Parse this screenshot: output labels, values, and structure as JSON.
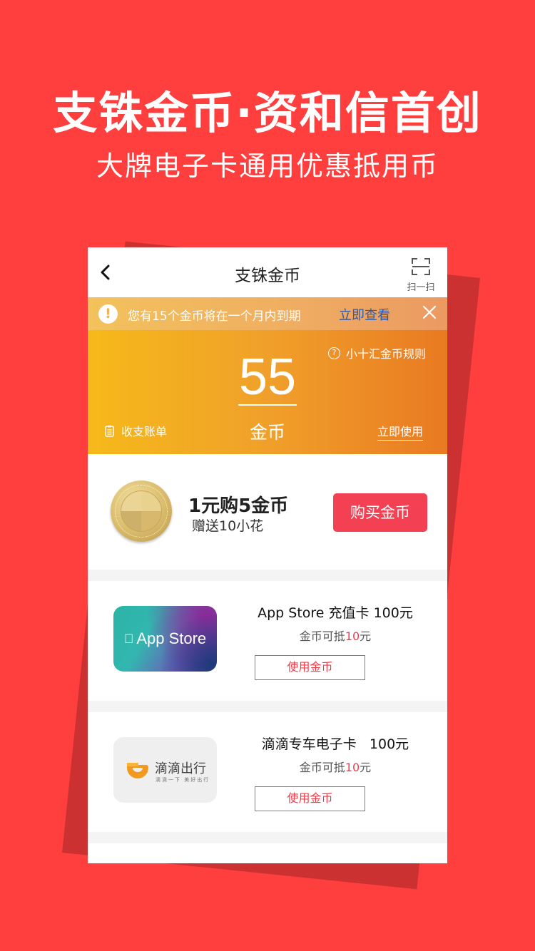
{
  "promo": {
    "headline": "支铢金币·资和信首创",
    "subline": "大牌电子卡通用优惠抵用币"
  },
  "navbar": {
    "title": "支铢金币",
    "back_icon": "chevron-left-icon",
    "scan_label": "扫一扫",
    "scan_icon": "scan-icon"
  },
  "notice": {
    "icon": "exclamation-icon",
    "text": "您有15个金币将在一个月内到期",
    "link": "立即查看",
    "close_icon": "close-icon"
  },
  "balance": {
    "rules_label": "小十汇金币规则",
    "rules_icon": "question-circle-icon",
    "value": "55",
    "unit": "金币",
    "bill_label": "收支账单",
    "bill_icon": "clipboard-icon",
    "use_now_label": "立即使用"
  },
  "buy": {
    "title": "1元购5金币",
    "subtitle": "赠送10小花",
    "button_label": "购买金币"
  },
  "cards": [
    {
      "brand_image_text": "App Store",
      "title": "App Store 充值卡 100元",
      "sub_prefix": "金币可抵",
      "sub_amount": "10",
      "sub_suffix": "元",
      "button_label": "使用金币"
    },
    {
      "brand_image_text": "滴滴出行",
      "brand_slogan": "滴滴一下 美好出行",
      "title": "滴滴专车电子卡   100元",
      "sub_prefix": "金币可抵",
      "sub_amount": "10",
      "sub_suffix": "元",
      "button_label": "使用金币"
    }
  ],
  "colors": {
    "background": "#ff3e3e",
    "shadow_card": "#cc3131",
    "accent_red": "#f34052",
    "balance_gradient_start": "#f6b91a",
    "balance_gradient_end": "#e97a22",
    "notice_link": "#2f5aa8"
  }
}
